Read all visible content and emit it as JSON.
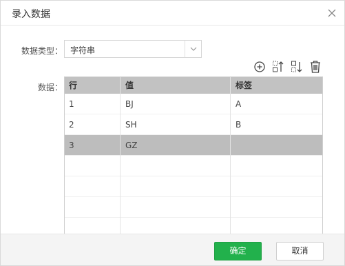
{
  "dialog": {
    "title": "录入数据"
  },
  "form": {
    "type_label": "数据类型：",
    "type_value": "字符串",
    "data_label": "数据："
  },
  "toolbar": {
    "icons": [
      "add-circle-icon",
      "move-up-icon",
      "move-down-icon",
      "trash-icon"
    ]
  },
  "table": {
    "columns": [
      "行",
      "值",
      "标签"
    ],
    "rows": [
      [
        "1",
        "BJ",
        "A"
      ],
      [
        "2",
        "SH",
        "B"
      ],
      [
        "3",
        "GZ",
        ""
      ]
    ],
    "selected_row": 3
  },
  "footer": {
    "ok_label": "确定",
    "cancel_label": "取消"
  },
  "colors": {
    "primary": "#22b14c",
    "selected_row": "#bdbdbd",
    "header_bg": "#c2c2c2"
  }
}
